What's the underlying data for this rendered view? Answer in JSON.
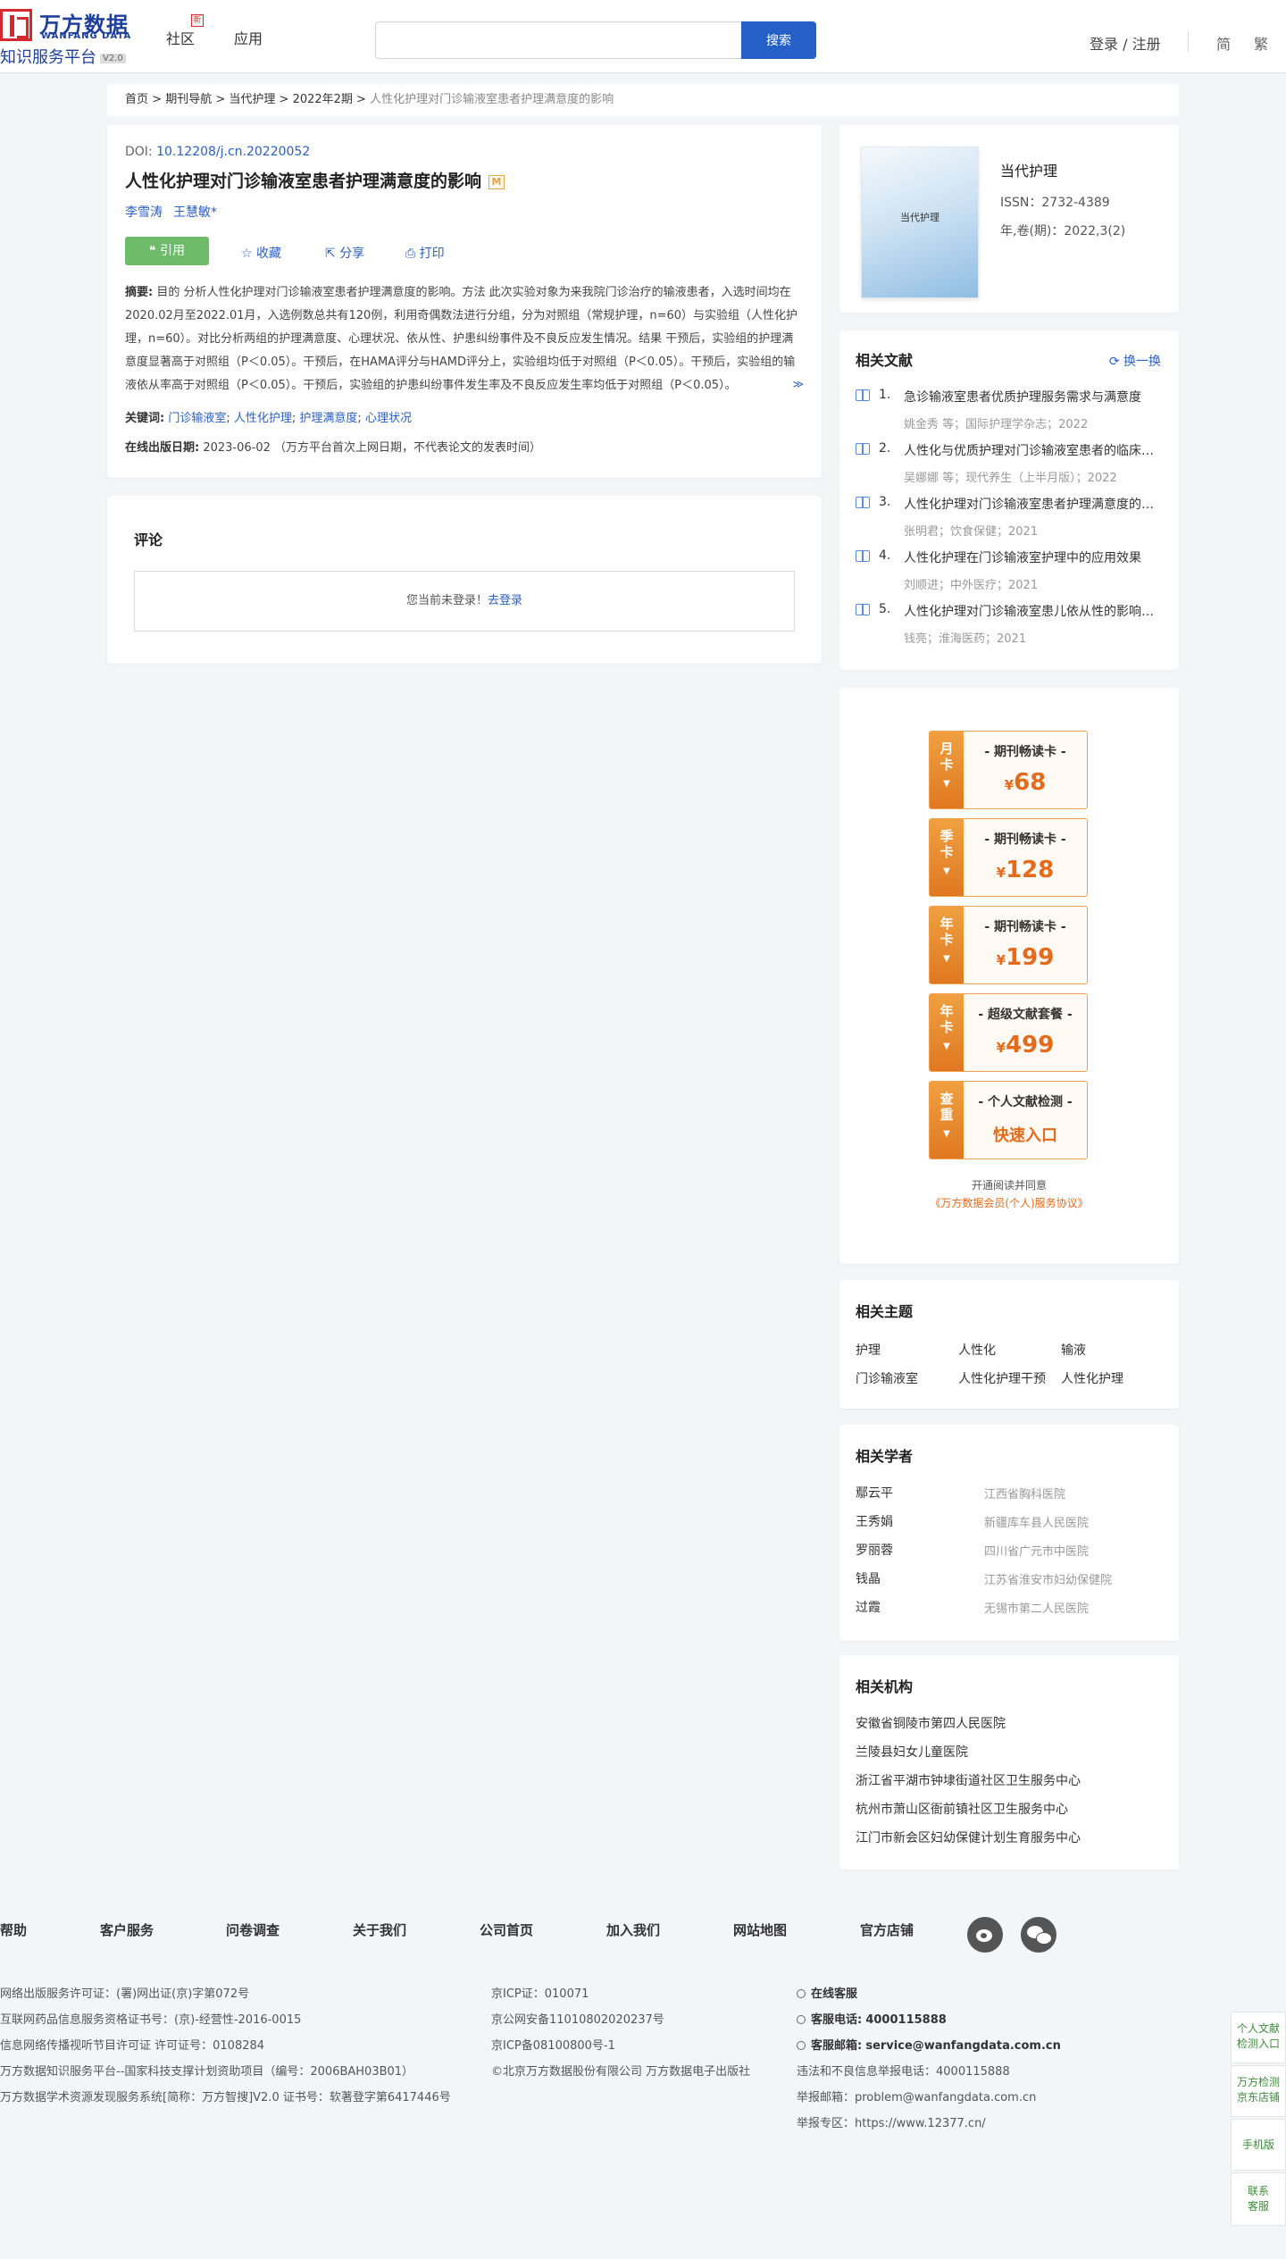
{
  "header": {
    "logo_cn": "万方数据",
    "logo_en": "WANFANG DATA",
    "logo_sub": "知识服务平台",
    "logo_version": "V2.0",
    "nav": [
      "社区",
      "应用"
    ],
    "search_placeholder": "",
    "search_button": "搜索",
    "login": "登录 / 注册",
    "lang_simplified": "简",
    "lang_traditional": "繁"
  },
  "breadcrumb": {
    "items": [
      "首页",
      "期刊导航",
      "当代护理",
      "2022年2期"
    ],
    "current": "人性化护理对门诊输液室患者护理满意度的影响",
    "sep": " > "
  },
  "article": {
    "doi_label": "DOI: ",
    "doi": "10.12208/j.cn.20220052",
    "title": "人性化护理对门诊输液室患者护理满意度的影响",
    "badge": "M",
    "authors": [
      "李雪涛",
      "王慧敏*"
    ],
    "cite": "❝ 引用",
    "favorite": "收藏",
    "share": "分享",
    "print": "打印",
    "abstract_label": "摘要:",
    "abstract": "目的 分析人性化护理对门诊输液室患者护理满意度的影响。方法 此次实验对象为来我院门诊治疗的输液患者，入选时间均在2020.02月至2022.01月，入选例数总共有120例，利用奇偶数法进行分组，分为对照组（常规护理，n=60）与实验组（人性化护理，n=60）。对比分析两组的护理满意度、心理状况、依从性、护患纠纷事件及不良反应发生情况。结果 干预后，实验组的护理满意度显著高于对照组（P＜0.05）。干预后，在HAMA评分与HAMD评分上，实验组均低于对照组（P＜0.05）。干预后，实验组的输液依从率高于对照组（P＜0.05）。干预后，实验组的护患纠纷事件发生率及不良反应发生率均低于对照组（P＜0.05）。",
    "expand": "≫",
    "keywords_label": "关键词:",
    "keywords": [
      "门诊输液室",
      "人性化护理",
      "护理满意度",
      "心理状况"
    ],
    "pubdate_label": "在线出版日期:",
    "pubdate": "2023-06-02",
    "pubdate_note": "（万方平台首次上网日期，不代表论文的发表时间）"
  },
  "comments": {
    "title": "评论",
    "notice": "您当前未登录！",
    "login_link": "去登录"
  },
  "journal": {
    "cover_title": "当代护理",
    "name": "当代护理",
    "issn": "ISSN：2732-4389",
    "volume": "年,卷(期)：2022,3(2)"
  },
  "related_docs": {
    "title": "相关文献",
    "swap": "换一换",
    "items": [
      {
        "num": "1.",
        "title": "急诊输液室患者优质护理服务需求与满意度",
        "meta": "姚金秀 等；国际护理学杂志；2022"
      },
      {
        "num": "2.",
        "title": "人性化与优质护理对门诊输液室患者的临床护理效果",
        "meta": "吴娜娜 等；现代养生（上半月版）；2022"
      },
      {
        "num": "3.",
        "title": "人性化护理对门诊输液室患者护理满意度的影响",
        "meta": "张明君；饮食保健；2021"
      },
      {
        "num": "4.",
        "title": "人性化护理在门诊输液室护理中的应用效果",
        "meta": "刘顺进；中外医疗；2021"
      },
      {
        "num": "5.",
        "title": "人性化护理对门诊输液室患儿依从性的影响分析",
        "meta": "钱亮；淮海医药；2021"
      }
    ]
  },
  "promo": {
    "cards": [
      {
        "tab": [
          "月",
          "卡"
        ],
        "name": "- 期刊畅读卡 -",
        "currency": "¥",
        "price": "68"
      },
      {
        "tab": [
          "季",
          "卡"
        ],
        "name": "- 期刊畅读卡 -",
        "currency": "¥",
        "price": "128"
      },
      {
        "tab": [
          "年",
          "卡"
        ],
        "name": "- 期刊畅读卡 -",
        "currency": "¥",
        "price": "199"
      },
      {
        "tab": [
          "年",
          "卡"
        ],
        "name": "- 超级文献套餐 -",
        "currency": "¥",
        "price": "499"
      },
      {
        "tab": [
          "查",
          "重"
        ],
        "name": "- 个人文献检测 -",
        "currency": "",
        "price": "快速入口"
      }
    ],
    "agree_text": "开通阅读并同意",
    "agree_link": "《万方数据会员(个人)服务协议》"
  },
  "topics": {
    "title": "相关主题",
    "items": [
      "护理",
      "人性化",
      "输液",
      "门诊输液室",
      "人性化护理干预",
      "人性化护理"
    ]
  },
  "scholars": {
    "title": "相关学者",
    "items": [
      {
        "name": "鄢云平",
        "org": "江西省胸科医院"
      },
      {
        "name": "王秀娟",
        "org": "新疆库车县人民医院"
      },
      {
        "name": "罗丽蓉",
        "org": "四川省广元市中医院"
      },
      {
        "name": "钱晶",
        "org": "江苏省淮安市妇幼保健院"
      },
      {
        "name": "过霞",
        "org": "无锡市第二人民医院"
      }
    ]
  },
  "institutions": {
    "title": "相关机构",
    "items": [
      "安徽省铜陵市第四人民医院",
      "兰陵县妇女儿童医院",
      "浙江省平湖市钟埭街道社区卫生服务中心",
      "杭州市萧山区衙前镇社区卫生服务中心",
      "江门市新会区妇幼保健计划生育服务中心"
    ]
  },
  "footer": {
    "links": [
      "帮助",
      "客户服务",
      "问卷调查",
      "关于我们",
      "公司首页",
      "加入我们",
      "网站地图",
      "官方店铺"
    ],
    "col1": [
      "网络出版服务许可证：(署)网出证(京)字第072号",
      "互联网药品信息服务资格证书号：(京)-经营性-2016-0015",
      "信息网络传播视听节目许可证 许可证号：0108284",
      "万方数据知识服务平台--国家科技支撑计划资助项目（编号：2006BAH03B01）",
      "万方数据学术资源发现服务系统[简称：万方智搜]V2.0 证书号：软著登字第6417446号"
    ],
    "col2": [
      "京ICP证：010071",
      "京公网安备11010802020237号",
      "京ICP备08100800号-1",
      "©北京万方数据股份有限公司 万方数据电子出版社"
    ],
    "service_title": "在线客服",
    "phone_label": "客服电话:",
    "phone": "4000115888",
    "email_label": "客服邮箱:",
    "email": "service@wanfangdata.com.cn",
    "report_phone": "违法和不良信息举报电话：4000115888",
    "report_email": "举报邮箱：problem@wanfangdata.com.cn",
    "report_zone": "举报专区：https://www.12377.cn/"
  },
  "side": {
    "items": [
      [
        "个人文献",
        "检测入口"
      ],
      [
        "万方检测",
        "京东店铺"
      ],
      [
        "手机版"
      ],
      [
        "联系",
        "客服"
      ]
    ]
  }
}
